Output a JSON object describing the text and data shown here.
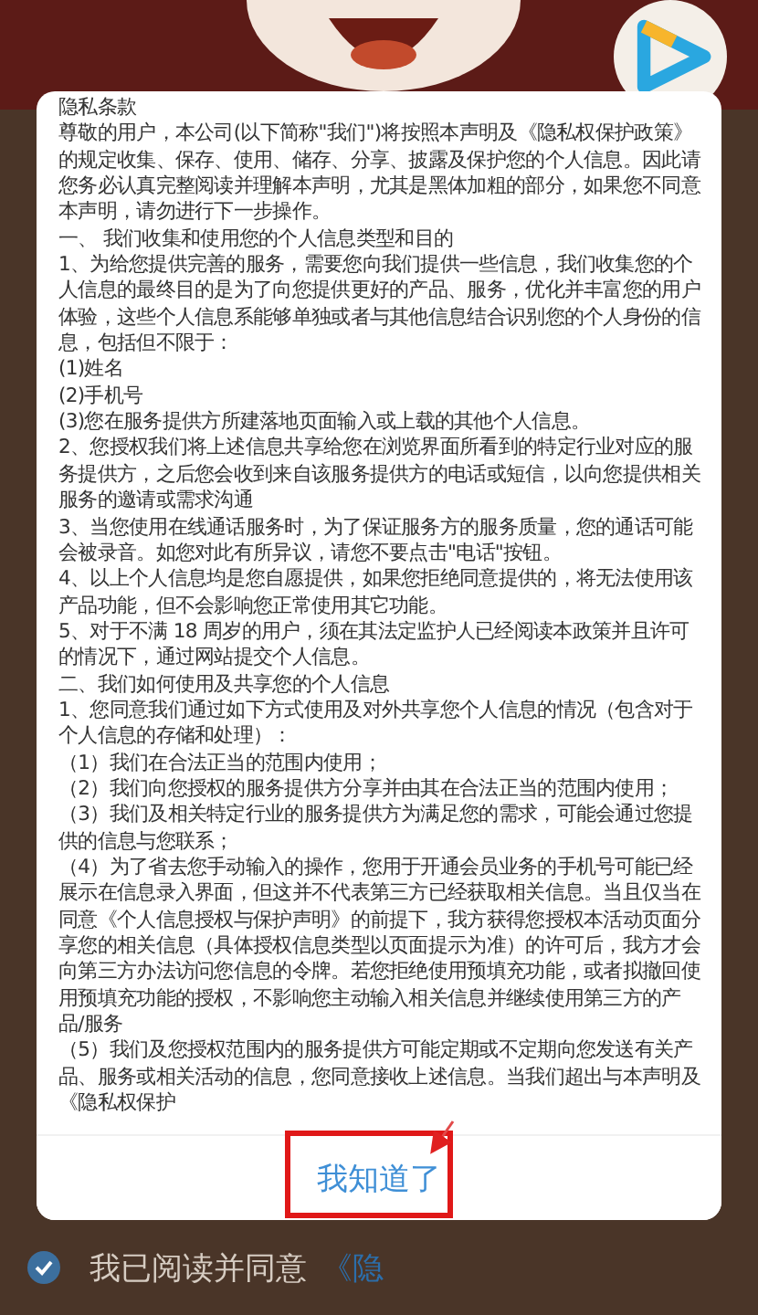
{
  "dialog": {
    "title": "隐私条款",
    "paragraphs": [
      "尊敬的用户，本公司(以下简称\"我们\")将按照本声明及《隐私权保护政策》的规定收集、保存、使用、储存、分享、披露及保护您的个人信息。因此请您务必认真完整阅读并理解本声明，尤其是黑体加粗的部分，如果您不同意本声明，请勿进行下一步操作。",
      "一、 我们收集和使用您的个人信息类型和目的",
      "1、为给您提供完善的服务，需要您向我们提供一些信息，我们收集您的个人信息的最终目的是为了向您提供更好的产品、服务，优化并丰富您的用户体验，这些个人信息系能够单独或者与其他信息结合识别您的个人身份的信息，包括但不限于：",
      "(1)姓名",
      "(2)手机号",
      "(3)您在服务提供方所建落地页面输入或上载的其他个人信息。",
      "2、您授权我们将上述信息共享给您在浏览界面所看到的特定行业对应的服务提供方，之后您会收到来自该服务提供方的电话或短信，以向您提供相关服务的邀请或需求沟通",
      "3、当您使用在线通话服务时，为了保证服务方的服务质量，您的通话可能会被录音。如您对此有所异议，请您不要点击\"电话\"按钮。",
      "4、以上个人信息均是您自愿提供，如果您拒绝同意提供的，将无法使用该产品功能，但不会影响您正常使用其它功能。",
      "5、对于不满 18 周岁的用户，须在其法定监护人已经阅读本政策并且许可的情况下，通过网站提交个人信息。",
      "二、我们如何使用及共享您的个人信息",
      "1、您同意我们通过如下方式使用及对外共享您个人信息的情况（包含对于个人信息的存储和处理）：",
      "（1）我们在合法正当的范围内使用；",
      "（2）我们向您授权的服务提供方分享并由其在合法正当的范围内使用；",
      "（3）我们及相关特定行业的服务提供方为满足您的需求，可能会通过您提供的信息与您联系；",
      "（4）为了省去您手动输入的操作，您用于开通会员业务的手机号可能已经展示在信息录入界面，但这并不代表第三方已经获取相关信息。当且仅当在同意《个人信息授权与保护声明》的前提下，我方获得您授权本活动页面分享您的相关信息（具体授权信息类型以页面提示为准）的许可后，我方才会向第三方办法访问您信息的令牌。若您拒绝使用预填充功能，或者拟撤回使用预填充功能的授权，不影响您主动输入相关信息并继续使用第三方的产品/服务",
      "（5）我们及您授权范围内的服务提供方可能定期或不定期向您发送有关产品、服务或相关活动的信息，您同意接收上述信息。当我们超出与本声明及《隐私权保护"
    ],
    "confirm_button": "我知道了"
  },
  "agreement": {
    "checked": true,
    "text": "我已阅读并同意",
    "link": "《隐"
  }
}
